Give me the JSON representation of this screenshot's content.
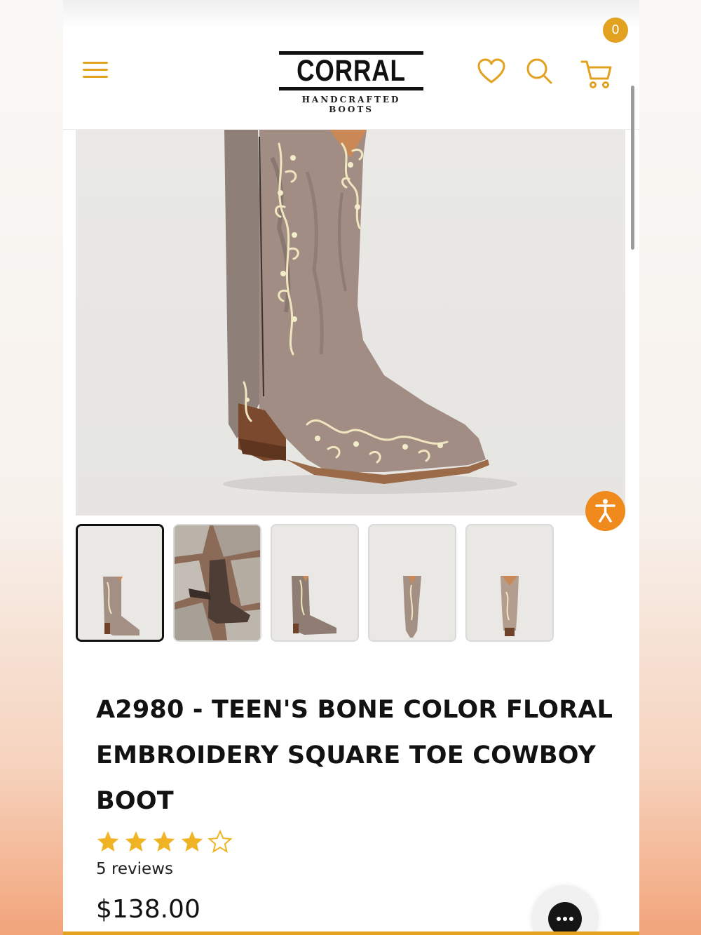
{
  "brand": {
    "name": "CORRAL",
    "tagline": "HANDCRAFTED BOOTS",
    "accent_color": "#e2a11e",
    "accessibility_color": "#f08a1c"
  },
  "header": {
    "menu_icon": "hamburger-menu-icon",
    "wishlist_icon": "heart-icon",
    "search_icon": "search-icon",
    "cart_icon": "cart-icon",
    "cart_count": "0"
  },
  "gallery": {
    "main_image": "boot-side-view",
    "thumbnails": [
      {
        "image": "boot-side-view",
        "active": true
      },
      {
        "image": "boot-on-stone-background",
        "active": false
      },
      {
        "image": "boot-side-view-alt",
        "active": false
      },
      {
        "image": "boot-front-view",
        "active": false
      },
      {
        "image": "boot-back-view",
        "active": false
      }
    ]
  },
  "product": {
    "title": "A2980 - TEEN'S BONE COLOR FLORAL EMBROIDERY SQUARE TOE COWBOY BOOT",
    "rating": 4,
    "rating_max": 5,
    "reviews_label": "5 reviews",
    "price": "$138.00"
  },
  "widgets": {
    "accessibility_icon": "accessibility-person-icon",
    "chat_icon": "chat-ellipsis-icon"
  }
}
